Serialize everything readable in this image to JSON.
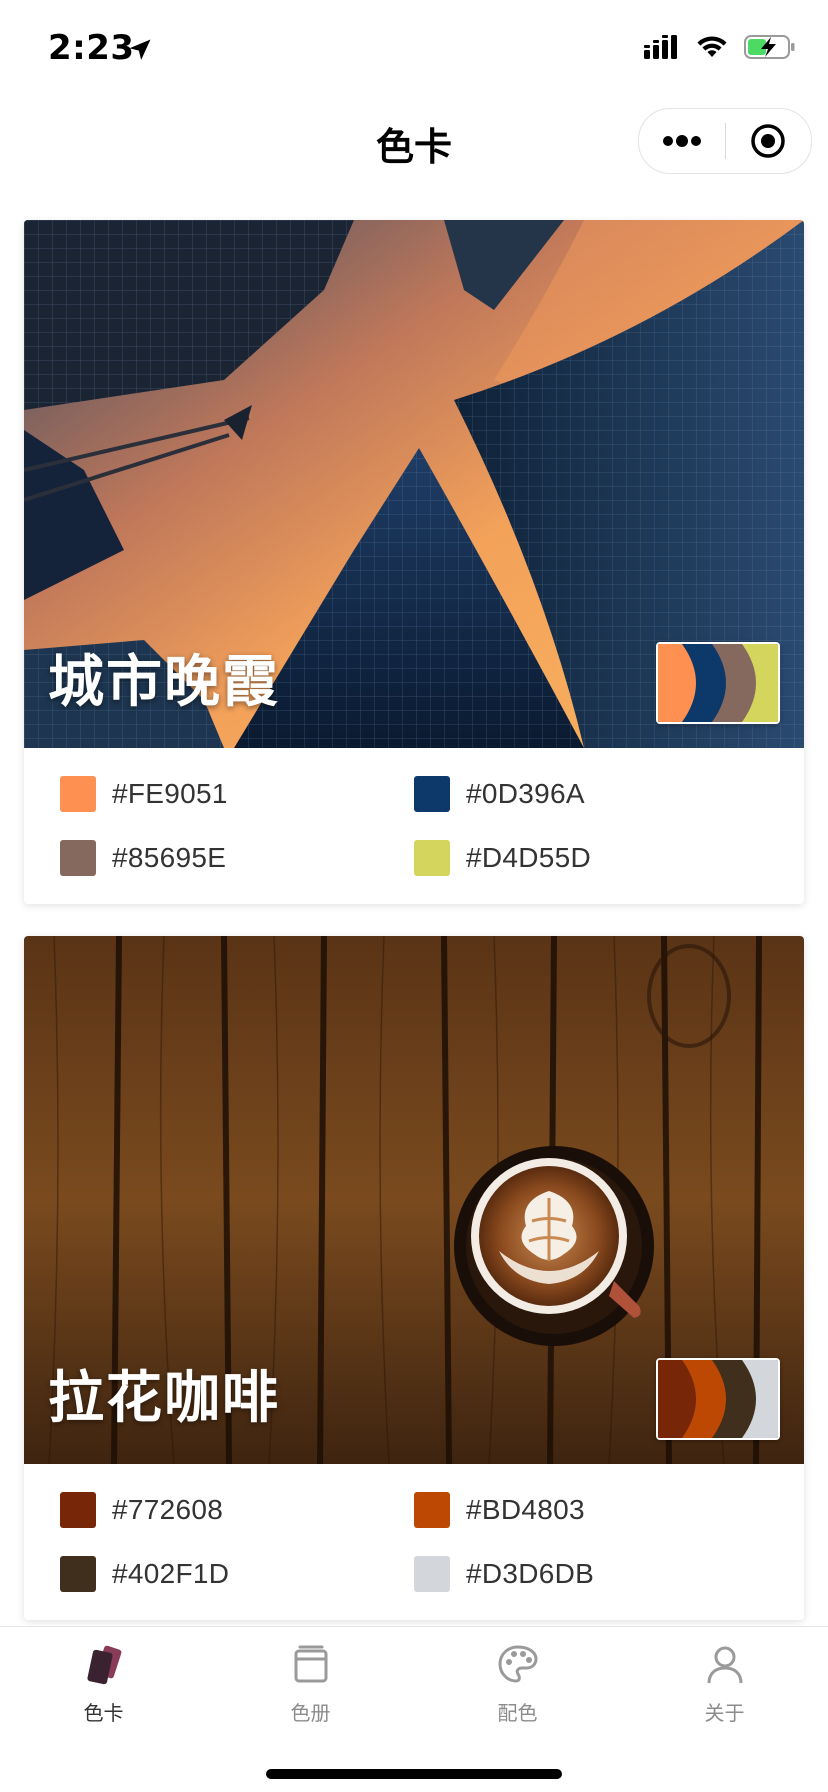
{
  "status_bar": {
    "time": "2:23",
    "icons": [
      "location-arrow-icon",
      "cellular-signal-icon",
      "wifi-icon",
      "battery-charging-icon"
    ]
  },
  "nav": {
    "title": "色卡",
    "capsule_icons": [
      "more-dots-icon",
      "target-circle-icon"
    ]
  },
  "cards": [
    {
      "title": "城市晚霞",
      "image": "city-sunset-photo",
      "colors": [
        {
          "code": "#FE9051",
          "hex": "#FE9051"
        },
        {
          "code": "#0D396A",
          "hex": "#0D396A"
        },
        {
          "code": "#85695E",
          "hex": "#85695E"
        },
        {
          "code": "#D4D55D",
          "hex": "#D4D55D"
        }
      ]
    },
    {
      "title": "拉花咖啡",
      "image": "latte-art-coffee-photo",
      "colors": [
        {
          "code": "#772608",
          "hex": "#772608"
        },
        {
          "code": "#BD4803",
          "hex": "#BD4803"
        },
        {
          "code": "#402F1D",
          "hex": "#402F1D"
        },
        {
          "code": "#D3D6DB",
          "hex": "#D3D6DB"
        }
      ]
    }
  ],
  "tab_bar": {
    "items": [
      {
        "label": "色卡",
        "icon": "cards-icon",
        "active": true
      },
      {
        "label": "色册",
        "icon": "album-icon",
        "active": false
      },
      {
        "label": "配色",
        "icon": "palette-icon",
        "active": false
      },
      {
        "label": "关于",
        "icon": "person-icon",
        "active": false
      }
    ],
    "active_color": "#333333",
    "inactive_color": "#8c8c8c"
  }
}
